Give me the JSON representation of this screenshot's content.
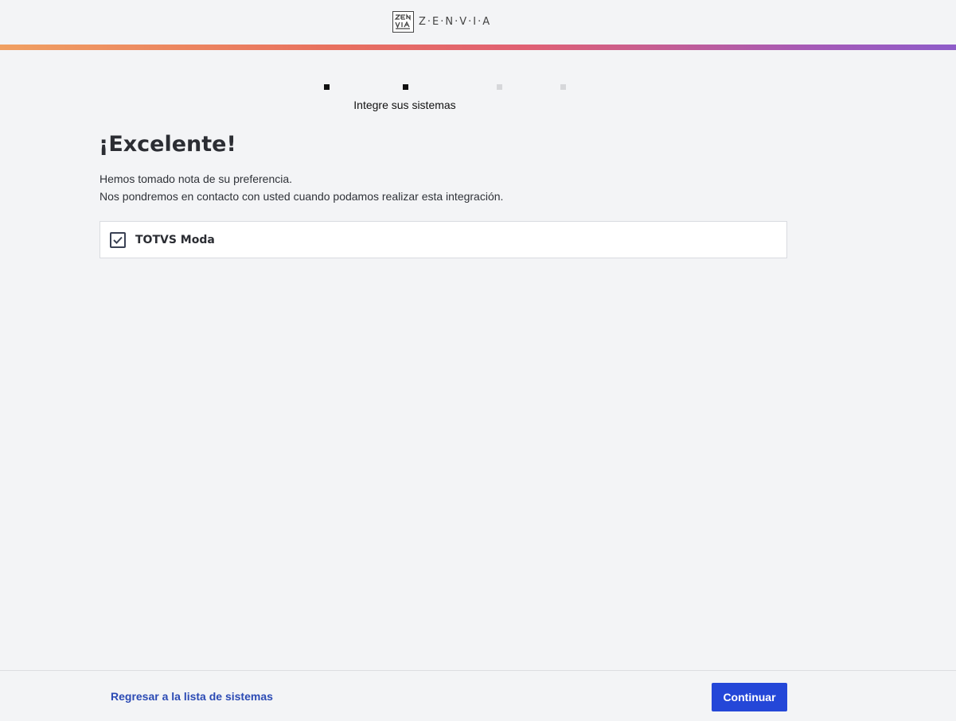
{
  "header": {
    "logo_text": "Z·E·N·V·I·A",
    "logo_icon": "zenvia-logo-icon"
  },
  "stepper": {
    "current_label": "Integre sus sistemas",
    "steps": [
      {
        "status": "done"
      },
      {
        "status": "done"
      },
      {
        "status": "pending"
      },
      {
        "status": "pending"
      }
    ]
  },
  "main": {
    "title": "¡Excelente!",
    "description_line1": "Hemos tomado nota de su preferencia.",
    "description_line2": "Nos pondremos en contacto con usted cuando podamos realizar esta integración.",
    "system": {
      "name": "TOTVS Moda",
      "checked": true
    }
  },
  "footer": {
    "back_label": "Regresar a la lista de sistemas",
    "continue_label": "Continuar"
  },
  "colors": {
    "accent": "#2447d8",
    "link": "#2b4ab4",
    "background": "#f3f4f6"
  }
}
